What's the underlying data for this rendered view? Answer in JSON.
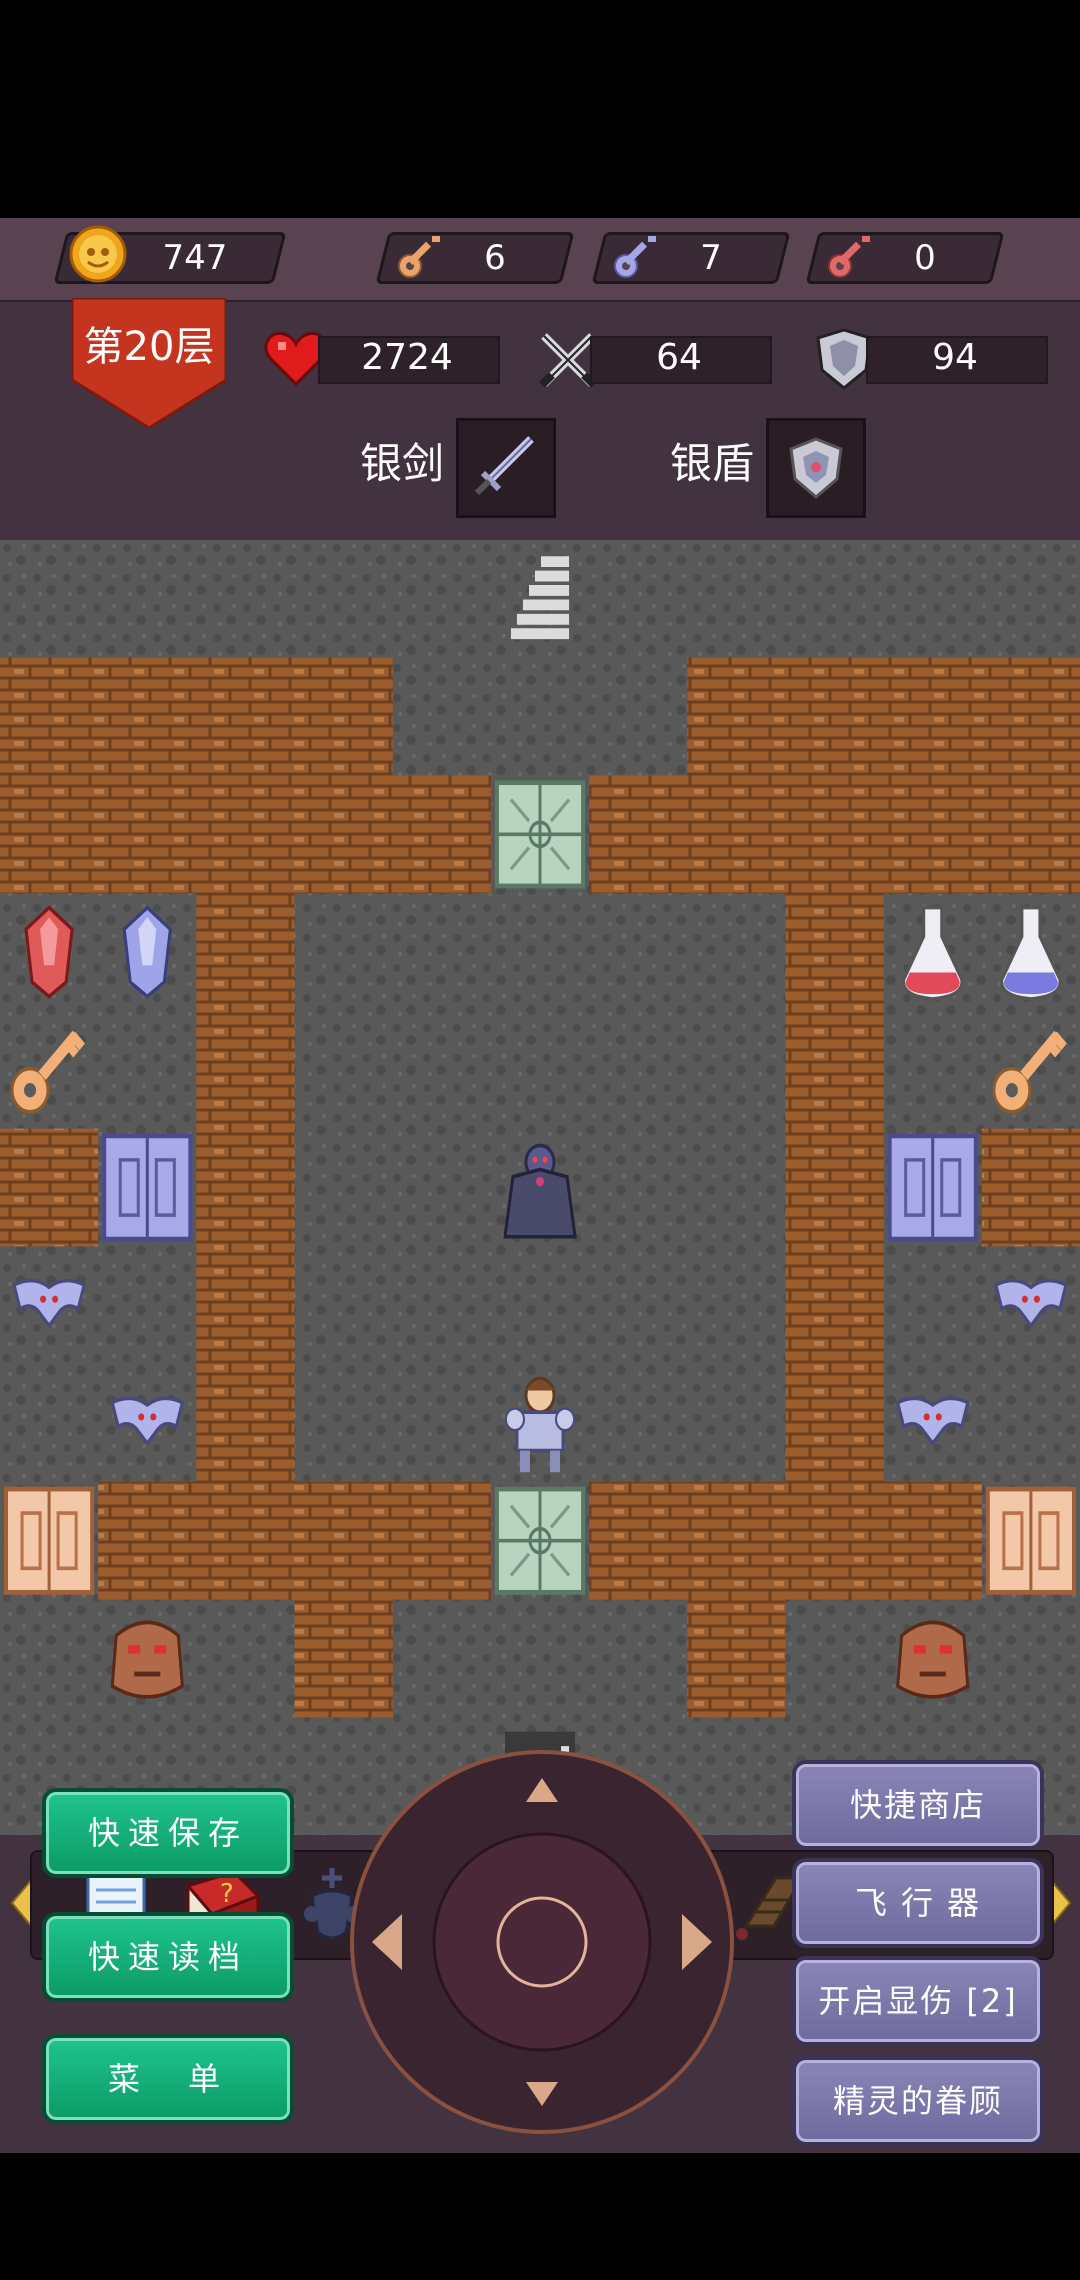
{
  "resources": {
    "gold": "747",
    "yellow_keys": "6",
    "blue_keys": "7",
    "red_keys": "0"
  },
  "hero": {
    "floor": "第20层",
    "hp": "2724",
    "attack": "64",
    "defense": "94",
    "weapon_label": "银剑",
    "shield_label": "银盾"
  },
  "map": {
    "grid_cols": 11,
    "grid_rows": 11,
    "tiles": [
      "FFFFFFFFFFF",
      "WWWWFFFWWWW",
      "WWWWWFWWWWW",
      "FFWFFFFFWFF",
      "FFWFFFFFWFF",
      "WFWFFFFFWFW",
      "FFWFFFFFWFF",
      "FFWFFFFFWFF",
      "FWWWWFWWWWF",
      "FFFWFFFWFFF",
      "FFFFFFFFFFF"
    ],
    "items": [
      {
        "col": 5,
        "row": 0,
        "kind": "stairs-up"
      },
      {
        "col": 5,
        "row": 2,
        "kind": "iron-gate"
      },
      {
        "col": 0,
        "row": 3,
        "kind": "red-gem"
      },
      {
        "col": 1,
        "row": 3,
        "kind": "blue-gem"
      },
      {
        "col": 9,
        "row": 3,
        "kind": "red-potion"
      },
      {
        "col": 10,
        "row": 3,
        "kind": "blue-potion"
      },
      {
        "col": 0,
        "row": 4,
        "kind": "yellow-key"
      },
      {
        "col": 10,
        "row": 4,
        "kind": "yellow-key"
      },
      {
        "col": 1,
        "row": 5,
        "kind": "blue-door"
      },
      {
        "col": 9,
        "row": 5,
        "kind": "blue-door"
      },
      {
        "col": 5,
        "row": 5,
        "kind": "vampire"
      },
      {
        "col": 0,
        "row": 6,
        "kind": "bat"
      },
      {
        "col": 10,
        "row": 6,
        "kind": "bat"
      },
      {
        "col": 1,
        "row": 7,
        "kind": "bat"
      },
      {
        "col": 9,
        "row": 7,
        "kind": "bat"
      },
      {
        "col": 5,
        "row": 7,
        "kind": "hero"
      },
      {
        "col": 0,
        "row": 8,
        "kind": "yellow-door"
      },
      {
        "col": 10,
        "row": 8,
        "kind": "yellow-door"
      },
      {
        "col": 5,
        "row": 8,
        "kind": "iron-gate"
      },
      {
        "col": 1,
        "row": 9,
        "kind": "golem"
      },
      {
        "col": 9,
        "row": 9,
        "kind": "golem"
      },
      {
        "col": 5,
        "row": 10,
        "kind": "stairs-down"
      }
    ]
  },
  "toolbar": {
    "items": [
      "notepad-icon",
      "monster-book-icon",
      "holy-water-icon",
      "pickaxe-icon",
      "fly-icon",
      "fly-down-icon",
      "fly-up-icon",
      "snowflake-icon",
      "dynamite-icon"
    ]
  },
  "buttons": {
    "quick_save": "快速保存",
    "quick_load": "快速读档",
    "menu": "菜　单",
    "shop": "快捷商店",
    "fly": "飞 行 器",
    "damage": "开启显伤 [2]",
    "fairy": "精灵的眷顾"
  },
  "colors": {
    "hp_heart": "#e01b1b",
    "green_button": "#12a874",
    "purple_button": "#7d78ab",
    "floor_badge": "#c4341e",
    "wall": "#9a5c30",
    "floor": "#5b5b5b"
  }
}
